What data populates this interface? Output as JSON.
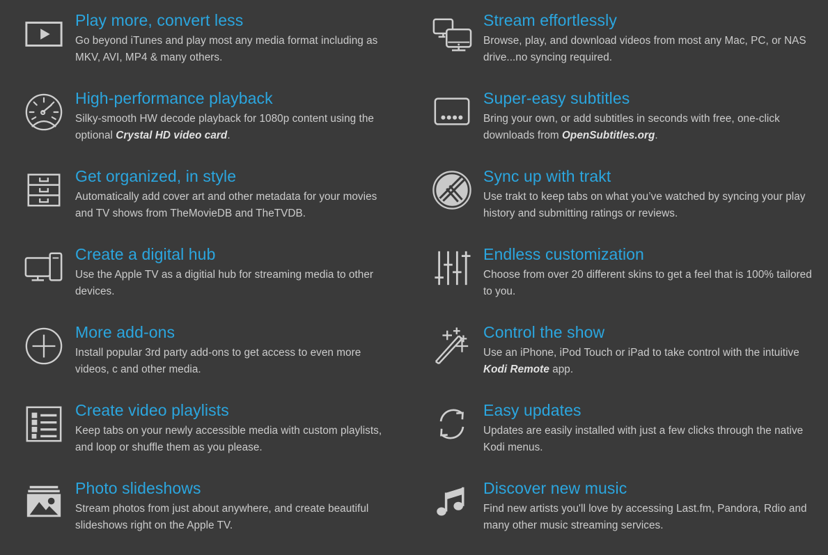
{
  "theme": {
    "background": "#3a3a3a",
    "title_color": "#2ba6df",
    "text_color": "#cccccc",
    "icon_color": "#cfcfcf"
  },
  "features": [
    {
      "column": "left",
      "icon": "play-video-icon",
      "title": "Play more, convert less",
      "desc_parts": [
        {
          "text": "Go beyond iTunes and play most any media format including as MKV, AVI, MP4 & many others.",
          "emphasis": false
        }
      ]
    },
    {
      "column": "right",
      "icon": "two-monitors-icon",
      "title": "Stream effortlessly",
      "desc_parts": [
        {
          "text": "Browse, play, and download videos from most any Mac, PC, or NAS drive...no syncing required.",
          "emphasis": false
        }
      ]
    },
    {
      "column": "left",
      "icon": "speedometer-icon",
      "title": "High-performance playback",
      "desc_parts": [
        {
          "text": "Silky-smooth HW decode playback for 1080p content using the optional ",
          "emphasis": false
        },
        {
          "text": "Crystal HD video card",
          "emphasis": true
        },
        {
          "text": ".",
          "emphasis": false
        }
      ]
    },
    {
      "column": "right",
      "icon": "subtitles-icon",
      "title": "Super-easy subtitles",
      "desc_parts": [
        {
          "text": "Bring your own, or add subtitles in seconds with free, one-click downloads from ",
          "emphasis": false
        },
        {
          "text": "OpenSubtitles.org",
          "emphasis": true
        },
        {
          "text": ".",
          "emphasis": false
        }
      ]
    },
    {
      "column": "left",
      "icon": "filing-cabinet-icon",
      "title": "Get organized, in style",
      "desc_parts": [
        {
          "text": "Automatically add cover art and other metadata for your movies and TV shows from TheMovieDB and TheTVDB.",
          "emphasis": false
        }
      ]
    },
    {
      "column": "right",
      "icon": "trakt-logo-icon",
      "title": "Sync up with trakt",
      "desc_parts": [
        {
          "text": "Use trakt to keep tabs on what you’ve watched by syncing your play history and submitting ratings or reviews.",
          "emphasis": false
        }
      ]
    },
    {
      "column": "left",
      "icon": "desktop-computer-icon",
      "title": "Create a digital hub",
      "desc_parts": [
        {
          "text": "Use the Apple TV as a digitial hub for streaming media to other devices.",
          "emphasis": false
        }
      ]
    },
    {
      "column": "right",
      "icon": "equalizer-sliders-icon",
      "title": "Endless customization",
      "desc_parts": [
        {
          "text": "Choose from over 20 different skins to get a feel that is 100% tailored to you.",
          "emphasis": false
        }
      ]
    },
    {
      "column": "left",
      "icon": "plus-circle-icon",
      "title": "More add-ons",
      "desc_parts": [
        {
          "text": "Install popular 3rd party add-ons to get access to even more videos, c and other media.",
          "emphasis": false
        }
      ]
    },
    {
      "column": "right",
      "icon": "magic-wand-icon",
      "title": "Control the show",
      "desc_parts": [
        {
          "text": "Use an iPhone, iPod Touch or iPad to take control with the intuitive ",
          "emphasis": false
        },
        {
          "text": "Kodi Remote",
          "emphasis": true
        },
        {
          "text": " app.",
          "emphasis": false
        }
      ]
    },
    {
      "column": "left",
      "icon": "playlist-icon",
      "title": "Create video playlists",
      "desc_parts": [
        {
          "text": "Keep tabs on your newly accessible media with custom playlists, and loop or shuffle them as you please.",
          "emphasis": false
        }
      ]
    },
    {
      "column": "right",
      "icon": "refresh-circle-icon",
      "title": "Easy updates",
      "desc_parts": [
        {
          "text": "Updates are easily installed with just a few clicks through the native Kodi menus.",
          "emphasis": false
        }
      ]
    },
    {
      "column": "left",
      "icon": "photo-image-icon",
      "title": "Photo slideshows",
      "desc_parts": [
        {
          "text": "Stream photos from just about anywhere, and create beautiful slideshows right on the Apple TV.",
          "emphasis": false
        }
      ]
    },
    {
      "column": "right",
      "icon": "music-note-icon",
      "title": "Discover new music",
      "desc_parts": [
        {
          "text": "Find new artists you'll love by accessing Last.fm, Pandora, Rdio and many other music streaming services.",
          "emphasis": false
        }
      ]
    }
  ]
}
